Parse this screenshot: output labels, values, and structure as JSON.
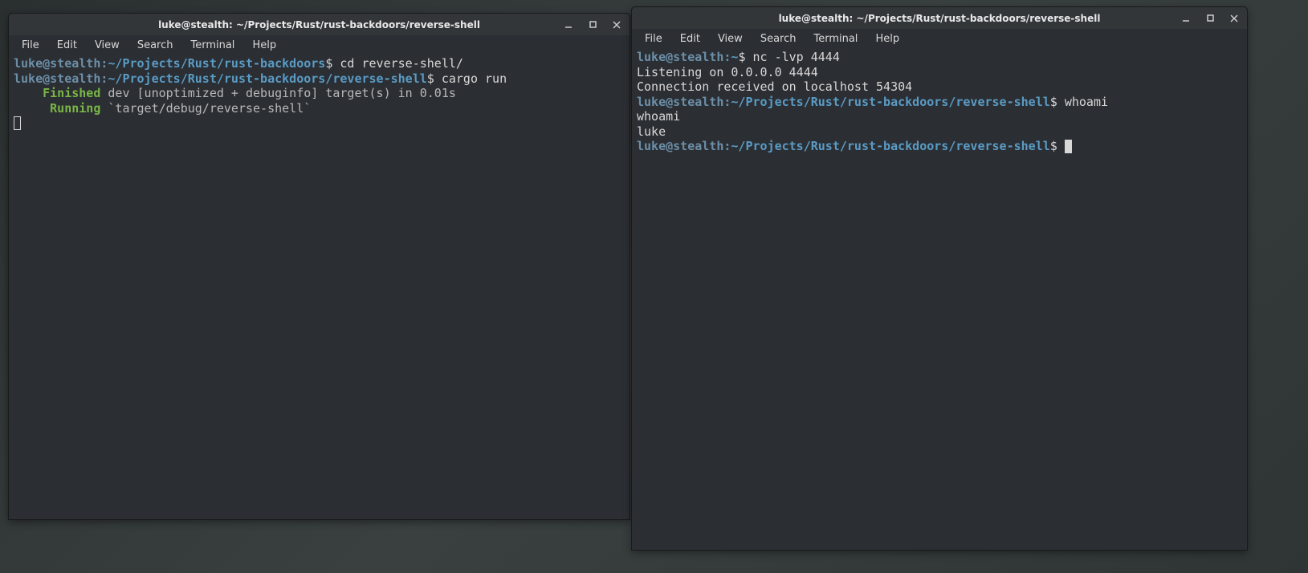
{
  "windows": {
    "left": {
      "title": "luke@stealth: ~/Projects/Rust/rust-backdoors/reverse-shell",
      "menu": [
        "File",
        "Edit",
        "View",
        "Search",
        "Terminal",
        "Help"
      ],
      "lines": [
        {
          "user_host": "luke@stealth",
          "colon": ":",
          "path": "~/Projects/Rust/rust-backdoors",
          "dollar": "$ ",
          "cmd": "cd reverse-shell/"
        },
        {
          "user_host": "luke@stealth",
          "colon": ":",
          "path": "~/Projects/Rust/rust-backdoors/reverse-shell",
          "dollar": "$ ",
          "cmd": "cargo run"
        },
        {
          "indent": "    ",
          "status": "Finished",
          "rest": " dev [unoptimized + debuginfo] target(s) in 0.01s"
        },
        {
          "indent": "     ",
          "status": "Running",
          "rest": " `target/debug/reverse-shell`"
        }
      ]
    },
    "right": {
      "title": "luke@stealth: ~/Projects/Rust/rust-backdoors/reverse-shell",
      "menu": [
        "File",
        "Edit",
        "View",
        "Search",
        "Terminal",
        "Help"
      ],
      "lines": [
        {
          "user_host": "luke@stealth",
          "colon": ":",
          "path": "~",
          "dollar": "$ ",
          "cmd": "nc -lvp 4444"
        },
        {
          "plain": "Listening on 0.0.0.0 4444"
        },
        {
          "plain": "Connection received on localhost 54304"
        },
        {
          "user_host": "luke@stealth",
          "colon": ":",
          "path": "~/Projects/Rust/rust-backdoors/reverse-shell",
          "dollar": "$ ",
          "cmd": "whoami"
        },
        {
          "plain": "whoami"
        },
        {
          "plain": "luke"
        },
        {
          "user_host": "luke@stealth",
          "colon": ":",
          "path": "~/Projects/Rust/rust-backdoors/reverse-shell",
          "dollar": "$ ",
          "cmd": ""
        }
      ]
    }
  }
}
